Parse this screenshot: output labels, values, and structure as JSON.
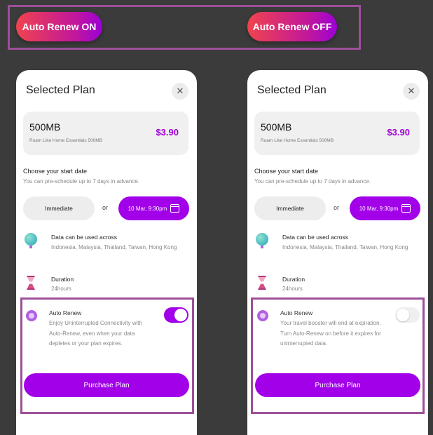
{
  "pills": {
    "on_label": "Auto Renew ON",
    "off_label": "Auto Renew OFF"
  },
  "cards": [
    {
      "title": "Selected Plan",
      "close": "✕",
      "plan_name": "500MB",
      "plan_sub": "Roam Like Home Essentials 500MB",
      "price": "$3.90",
      "start_title": "Choose your start date",
      "start_sub": "You can pre-schedule up to 7 days in advance.",
      "immediate": "Immediate",
      "or": "or",
      "date": "10 Mar, 9:30pm",
      "data_title": "Data can be used across",
      "data_text": "Indonesia, Malaysia, Thailand, Taiwan, Hong Kong",
      "duration_title": "Duration",
      "duration_text": "24hours",
      "renew_title": "Auto Renew",
      "renew_text": "Enjoy Uninterrupted Connectivity with Auto-Renew, even when your data depletes or your plan expires.",
      "renew_on": true,
      "purchase": "Purchase Plan"
    },
    {
      "title": "Selected Plan",
      "close": "✕",
      "plan_name": "500MB",
      "plan_sub": "Roam Like Home Essentials 500MB",
      "price": "$3.90",
      "start_title": "Choose your start date",
      "start_sub": "You can pre-schedule up to 7 days in advance.",
      "immediate": "Immediate",
      "or": "or",
      "date": "10 Mar, 9:30pm",
      "data_title": "Data can be used across",
      "data_text": "Indonesia, Malaysia, Thailand, Taiwan, Hong Kong",
      "duration_title": "Duration",
      "duration_text": "24hours",
      "renew_title": "Auto Renew",
      "renew_text": "Your travel booster will end at expiration. Turn Auto-Renew on before it expires for uninterrupted data.",
      "renew_on": false,
      "purchase": "Purchase Plan"
    }
  ],
  "colors": {
    "accent": "#a100e8",
    "highlight_frame": "#9c4f99",
    "background": "#3b3b3b"
  }
}
